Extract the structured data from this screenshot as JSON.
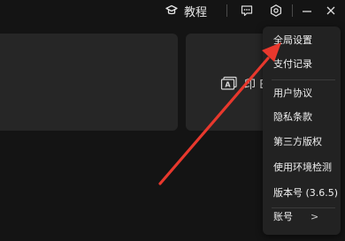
{
  "header": {
    "tutorial_label": "教程",
    "tutorial_icon": "graduation-cap-icon",
    "feedback_icon": "feedback-icon",
    "settings_icon": "settings-gear-icon",
    "minimize_icon": "minimize-icon",
    "close_icon": "close-icon"
  },
  "main": {
    "card_right_text": "印 E",
    "card_right_icon": "screen-a-icon"
  },
  "menu": {
    "items": [
      {
        "label": "全局设置"
      },
      {
        "label": "支付记录"
      },
      {
        "label": "用户协议"
      },
      {
        "label": "隐私条款"
      },
      {
        "label": "第三方版权"
      },
      {
        "label": "使用环境检测"
      },
      {
        "label": "版本号 (3.6.5)"
      },
      {
        "label": "账号",
        "chevron": ">"
      }
    ]
  },
  "colors": {
    "background": "#141414",
    "card": "#262626",
    "menu": "#222222",
    "annotation_arrow": "#e8382d"
  }
}
